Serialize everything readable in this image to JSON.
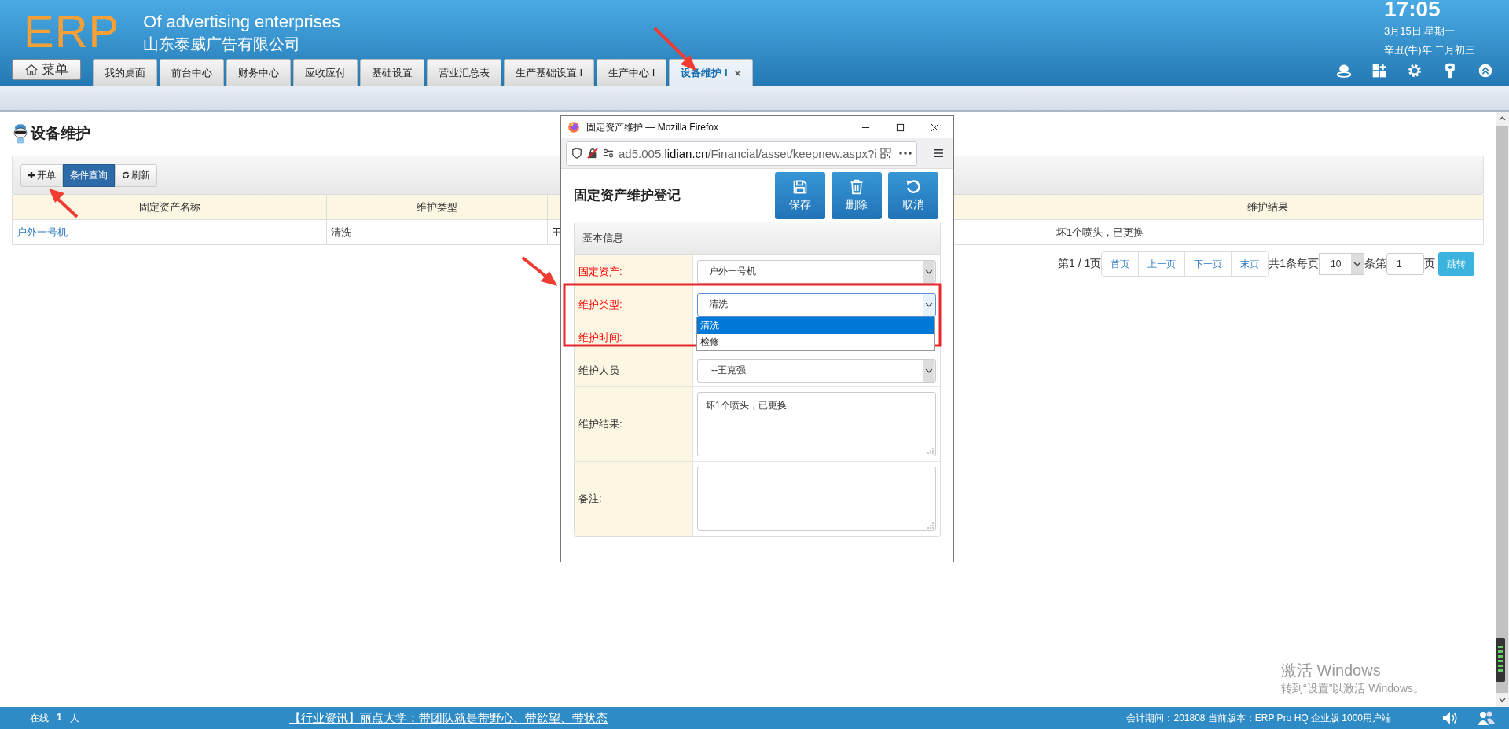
{
  "header": {
    "logo": "ERP",
    "subtitle": "Of advertising enterprises",
    "company": "山东泰威广告有限公司",
    "clock": {
      "time": "17:05",
      "date": "3月15日 星期一",
      "lunar": "辛丑(牛)年 二月初三"
    }
  },
  "menu_button": "菜单",
  "tabs": [
    {
      "label": "我的桌面",
      "selected": false,
      "closable": false
    },
    {
      "label": "前台中心",
      "selected": false,
      "closable": false
    },
    {
      "label": "财务中心",
      "selected": false,
      "closable": false
    },
    {
      "label": "应收应付",
      "selected": false,
      "closable": false
    },
    {
      "label": "基础设置",
      "selected": false,
      "closable": false
    },
    {
      "label": "营业汇总表",
      "selected": false,
      "closable": false
    },
    {
      "label": "生产基础设置 I",
      "selected": false,
      "closable": false
    },
    {
      "label": "生产中心 I",
      "selected": false,
      "closable": false
    },
    {
      "label": "设备维护 I",
      "selected": true,
      "closable": true
    }
  ],
  "page": {
    "title": "设备维护",
    "toolbar": [
      {
        "label": "开单",
        "kind": "add"
      },
      {
        "label": "条件查询",
        "kind": "primary"
      },
      {
        "label": "刷新",
        "kind": "refresh"
      }
    ]
  },
  "table": {
    "columns": [
      "固定资产名称",
      "维护类型",
      "维护结果"
    ],
    "rows": [
      {
        "cells": [
          "户外一号机",
          "清洗",
          "王",
          "坏1个喷头，已更换"
        ]
      }
    ]
  },
  "pagination": {
    "page_info": "第1 / 1页",
    "buttons": [
      "首页",
      "上一页",
      "下一页",
      "末页"
    ],
    "total": "共1条每页",
    "page_size": "10",
    "per": "条第",
    "page_input": "1",
    "page_suffix": "页",
    "go": "跳转"
  },
  "dialog": {
    "title": "固定资产维护 — Mozilla Firefox",
    "url": {
      "host": "ad5.005.",
      "domain": "lidian.cn",
      "path": "/Financial/asset/keepnew.aspx?i"
    },
    "heading": "固定资产维护登记",
    "actions": [
      {
        "label": "保存",
        "kind": "save"
      },
      {
        "label": "删除",
        "kind": "delete"
      },
      {
        "label": "取消",
        "kind": "cancel"
      }
    ],
    "section": "基本信息",
    "fields": [
      {
        "label": "固定资产:",
        "required": true,
        "kind": "select",
        "value": "户外一号机",
        "open": false
      },
      {
        "label": "维护类型:",
        "required": true,
        "kind": "select",
        "value": "清洗",
        "open": true
      },
      {
        "label": "维护时间:",
        "required": true,
        "kind": "date"
      },
      {
        "label": "维护人员",
        "required": false,
        "kind": "select",
        "value": "|--王克强",
        "open": false
      },
      {
        "label": "维护结果:",
        "required": false,
        "kind": "textarea",
        "value": "坏1个喷头，已更换"
      },
      {
        "label": "备注:",
        "required": false,
        "kind": "textarea"
      }
    ],
    "dropdown_options": [
      {
        "label": "清洗",
        "selected": true
      },
      {
        "label": "检修",
        "selected": false
      }
    ]
  },
  "footer": {
    "online_label": "在线",
    "online_count": "1",
    "online_unit": "人",
    "news": "【行业资讯】丽点大学：带团队就是带野心、带欲望、带状态",
    "info": "会计期间：201808 当前版本：ERP Pro HQ 企业版 1000用户端"
  },
  "os_notice": {
    "title": "激活 Windows",
    "text": "转到“设置”以激活 Windows。"
  }
}
